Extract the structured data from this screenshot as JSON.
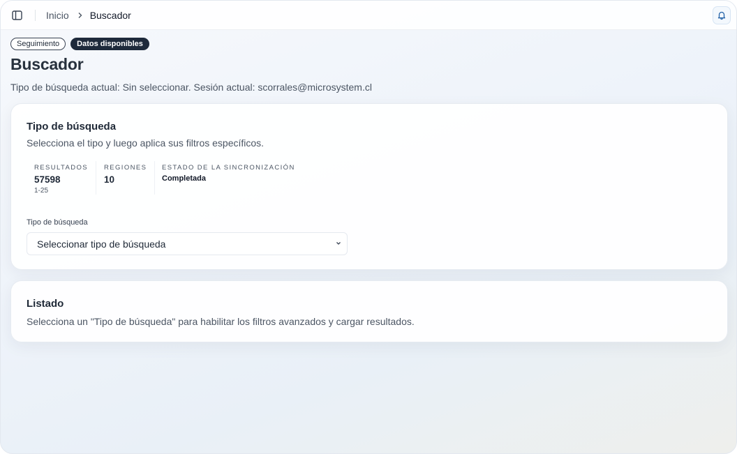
{
  "header": {
    "breadcrumb": [
      {
        "label": "Inicio"
      },
      {
        "label": "Buscador"
      }
    ]
  },
  "badges": {
    "seguimiento": "Seguimiento",
    "datos_disponibles": "Datos disponibles"
  },
  "page": {
    "title": "Buscador",
    "subtitle": "Tipo de búsqueda actual: Sin seleccionar. Sesión actual: scorrales@microsystem.cl"
  },
  "search_card": {
    "title": "Tipo de búsqueda",
    "description": "Selecciona el tipo y luego aplica sus filtros específicos.",
    "stats": {
      "resultados": {
        "label": "RESULTADOS",
        "value": "57598",
        "range": "1-25"
      },
      "regiones": {
        "label": "REGIONES",
        "value": "10"
      },
      "estado": {
        "label": "ESTADO DE LA SINCRONIZACIÓN",
        "value": "Completada"
      }
    },
    "field_label": "Tipo de búsqueda",
    "select_value": "Seleccionar tipo de búsqueda"
  },
  "list_card": {
    "title": "Listado",
    "description": "Selecciona un \"Tipo de búsqueda\" para habilitar los filtros avanzados y cargar resultados."
  },
  "icons": {
    "sidebar_toggle": "sidebar-toggle-icon",
    "breadcrumb_separator": "chevron-right-icon",
    "notifications": "bell-icon",
    "select_chevron": "chevron-down-icon"
  },
  "colors": {
    "badge_dark": "#1e2a3b",
    "bell_border": "#d6e4f3"
  }
}
